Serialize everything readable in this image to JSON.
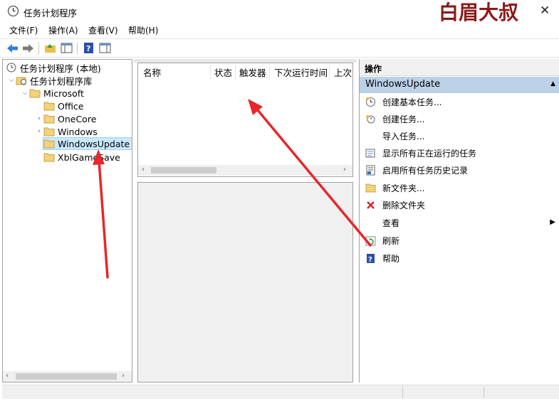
{
  "window": {
    "title": "任务计划程序",
    "watermark": "白眉大叔"
  },
  "menu": {
    "items": [
      "文件(F)",
      "操作(A)",
      "查看(V)",
      "帮助(H)"
    ]
  },
  "tree": {
    "root": "任务计划程序 (本地)",
    "library": "任务计划程序库",
    "microsoft": "Microsoft",
    "office": "Office",
    "onecore": "OneCore",
    "windows": "Windows",
    "windowsupdate": "WindowsUpdate",
    "xblgamesave": "XblGameSave"
  },
  "task_list": {
    "columns": [
      "名称",
      "状态",
      "触发器",
      "下次运行时间",
      "上次"
    ]
  },
  "actions": {
    "header": "操作",
    "section": "WindowsUpdate",
    "items": [
      {
        "label": "创建基本任务...",
        "icon": "create-basic-task-icon"
      },
      {
        "label": "创建任务...",
        "icon": "create-task-icon"
      },
      {
        "label": "导入任务...",
        "icon": ""
      },
      {
        "label": "显示所有正在运行的任务",
        "icon": "running-tasks-icon"
      },
      {
        "label": "启用所有任务历史记录",
        "icon": "history-icon"
      },
      {
        "label": "新文件夹...",
        "icon": "folder-icon"
      },
      {
        "label": "删除文件夹",
        "icon": "delete-icon"
      },
      {
        "label": "查看",
        "icon": ""
      },
      {
        "label": "刷新",
        "icon": "refresh-icon"
      },
      {
        "label": "帮助",
        "icon": "help-icon"
      }
    ]
  },
  "colors": {
    "annotation_arrow": "#e8262b",
    "selection": "#cce8ff",
    "section_header": "#bcd1e8",
    "watermark": "#8b1a1a"
  }
}
